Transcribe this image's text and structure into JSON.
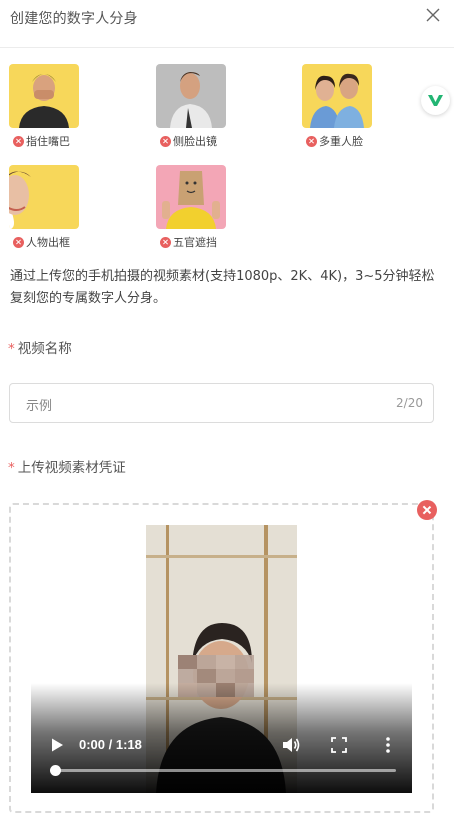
{
  "header": {
    "title": "创建您的数字人分身"
  },
  "examples": [
    {
      "label": "指住嘴巴"
    },
    {
      "label": "侧脸出镜"
    },
    {
      "label": "多重人脸"
    },
    {
      "label": "人物出框"
    },
    {
      "label": "五官遮挡"
    }
  ],
  "description": "通过上传您的手机拍摄的视频素材(支持1080p、2K、4K)，3~5分钟轻松复刻您的专属数字人分身。",
  "form": {
    "name_label": "视频名称",
    "name_required": "*",
    "name_placeholder": "示例",
    "name_counter": "2/20",
    "upload_label": "上传视频素材凭证",
    "upload_required": "*"
  },
  "video": {
    "time": "0:00 / 1:18",
    "progress": 0.0
  },
  "colors": {
    "required_star": "#e8605f",
    "remove_badge": "#e8605f",
    "brand_badge": "#22b573",
    "example_bg_yellow": "#f7d75a",
    "example_bg_pink": "#f3a6b6",
    "example_bg_gray": "#bdbdbd"
  },
  "icons": [
    "close-icon",
    "brand-v-icon",
    "error-x-icon",
    "remove-x-icon",
    "play-icon",
    "volume-icon",
    "fullscreen-icon",
    "more-vertical-icon"
  ]
}
